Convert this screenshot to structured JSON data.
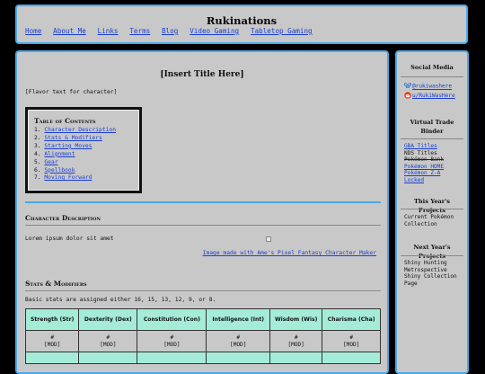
{
  "header": {
    "site_title": "Rukinations",
    "nav": [
      {
        "label": "Home"
      },
      {
        "label": "About Me"
      },
      {
        "label": "Links"
      },
      {
        "label": "Terms"
      },
      {
        "label": "Blog"
      },
      {
        "label": "Video Gaming"
      },
      {
        "label": "Tabletop Gaming"
      }
    ]
  },
  "main": {
    "title": "[Insert Title Here]",
    "flavor": "[Flavor text for character]",
    "toc": {
      "title": "Table of Contents",
      "items": [
        {
          "num": "1.",
          "label": "Character Description"
        },
        {
          "num": "2.",
          "label": "Stats & Modifiers"
        },
        {
          "num": "3.",
          "label": "Starting Moves"
        },
        {
          "num": "4.",
          "label": "Alignment"
        },
        {
          "num": "5.",
          "label": "Gear"
        },
        {
          "num": "6.",
          "label": "Spellbook"
        },
        {
          "num": "7.",
          "label": "Moving Forward"
        }
      ]
    },
    "description": {
      "heading": "Character Description",
      "text": "Lorem ipsum dolor sit amet",
      "caption": "Image made with Ame's Pixel Fantasy Character Maker"
    },
    "stats": {
      "heading": "Stats & Modifiers",
      "text": "Basic stats are assigned either 16, 15, 13, 12, 9, or 8.",
      "columns": [
        "Strength (Str)",
        "Dexterity (Dex)",
        "Constitution (Con)",
        "Intelligence (Int)",
        "Wisdom (Wis)",
        "Charisma (Cha)"
      ],
      "value": "#",
      "mod": "[MOD]"
    }
  },
  "sidebar": {
    "social_heading": "Social Media",
    "social": [
      {
        "icon": "butterfly-icon",
        "label": "@rukiwashere"
      },
      {
        "icon": "reddit-icon",
        "label": "u/RukiWasHere"
      }
    ],
    "trade_heading": "Virtual Trade Binder",
    "trade_items": [
      {
        "label": "GBA Titles",
        "style": "link"
      },
      {
        "label": "NDS Titles",
        "style": "plain"
      },
      {
        "label": "Pokémon Bank",
        "style": "strike"
      },
      {
        "label": "Pokémon HOME",
        "style": "link"
      },
      {
        "label": "Pokémon Z-A",
        "style": "link"
      },
      {
        "label": "Locked",
        "style": "link"
      }
    ],
    "this_year_heading": "This Year's Projects",
    "this_year_text": "Current Pokémon Collection",
    "next_year_heading": "Next Year's Projects",
    "next_year_text": "Shiny Hunting Metrospective Shiny Collection Page",
    "colors": {
      "accent": "#4aa8e8",
      "panel": "#c8c8c8",
      "table_header": "#a4ecd8",
      "link": "#1a3fd0"
    }
  }
}
